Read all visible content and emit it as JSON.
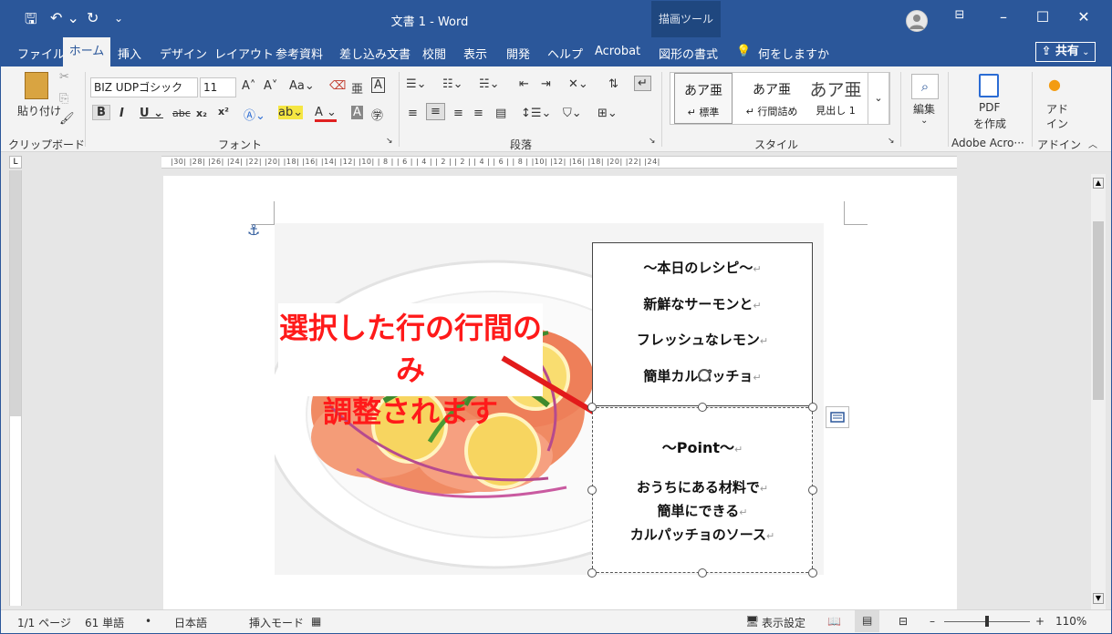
{
  "titlebar": {
    "doc_title": "文書 1  -  Word",
    "context_tools": "描画ツール",
    "undo_icon": "↶ ⌄",
    "redo_icon": "↻",
    "qat_more": "⌄"
  },
  "tabs": [
    "ファイル",
    "挿入",
    "デザイン",
    "レイアウト",
    "参考資料",
    "差し込み文書",
    "校閲",
    "表示",
    "開発",
    "ヘルプ",
    "Acrobat",
    "図形の書式"
  ],
  "active_tab": "ホーム",
  "tell_me": "何をしますか",
  "share": "共有",
  "ribbon": {
    "paste_label": "貼り付け",
    "font_name": "BIZ UDPゴシック",
    "font_size": "11",
    "groups": {
      "clipboard": "クリップボード",
      "font": "フォント",
      "paragraph": "段落",
      "styles": "スタイル",
      "adobe": "Adobe Acro···",
      "addin": "アドイン"
    },
    "styles": [
      {
        "sample": "あア亜",
        "name": "↵ 標準"
      },
      {
        "sample": "あア亜",
        "name": "↵ 行間詰め"
      },
      {
        "sample": "あア亜",
        "name": "見出し 1"
      }
    ],
    "edit_label": "編集",
    "pdf_label_1": "PDF",
    "pdf_label_2": "を作成",
    "addin_label_1": "アド",
    "addin_label_2": "イン"
  },
  "ruler_text": "|30| |28| |26| |24| |22| |20| |18| |16| |14| |12| |10| | 8 | | 6 | | 4 | | 2 |    | 2 | | 4 | | 6 | | 8 | |10| |12|    |16| |18| |20| |22| |24|",
  "callout": {
    "line1": "選択した行の行間のみ",
    "line2": "調整されます"
  },
  "textbox1": {
    "lines": [
      "～本日のレシピ～",
      "新鮮なサーモンと",
      "フレッシュなレモン",
      "簡単カルパッチョ"
    ]
  },
  "textbox2": {
    "lines": [
      "～Point～",
      "おうちにある材料で",
      "簡単にできる",
      "カルパッチョのソース"
    ]
  },
  "paragraph_mark": "↵",
  "status": {
    "page": "1/1 ページ",
    "words": "61 単語",
    "lang": "日本語",
    "mode": "挿入モード",
    "display_settings": "表示設定",
    "zoom": "110%"
  },
  "colors": {
    "accent": "#2b579a",
    "callout_text": "#ff1a1a",
    "arrow": "#e21b1b"
  }
}
